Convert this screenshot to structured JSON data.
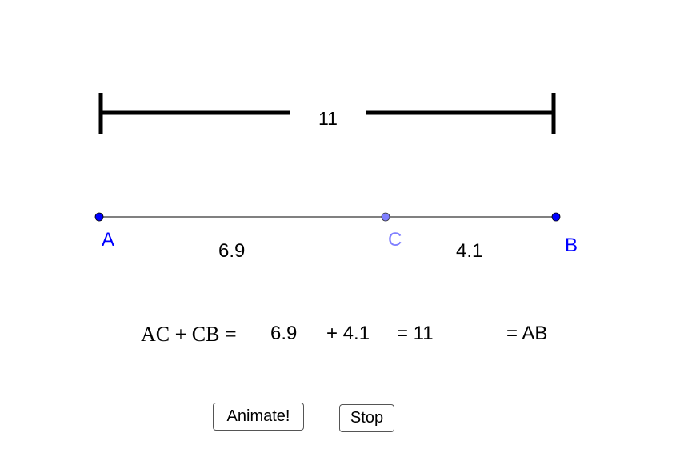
{
  "diagram": {
    "total_length_label": "11",
    "points": {
      "A": {
        "label": "A",
        "color": "#0000ff"
      },
      "B": {
        "label": "B",
        "color": "#0000ff"
      },
      "C": {
        "label": "C",
        "color": "#7f7fff"
      }
    },
    "segment_labels": {
      "AC": "6.9",
      "CB": "4.1"
    },
    "values": {
      "AB": 11,
      "AC": 6.9,
      "CB": 4.1
    }
  },
  "equation": {
    "lhs": "AC + CB =",
    "ac_value": "6.9",
    "plus_cb": "+ 4.1",
    "equals_total": "= 11",
    "equals_ab": "= AB"
  },
  "buttons": {
    "animate": "Animate!",
    "stop": "Stop"
  },
  "colors": {
    "point_primary": "#0000ff",
    "point_dependent": "#7f7fff",
    "line": "#000000"
  }
}
